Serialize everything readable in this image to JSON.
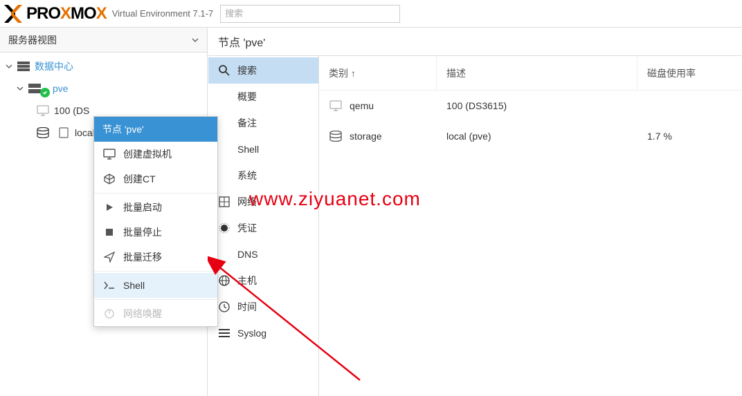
{
  "header": {
    "brand_pro": "PRO",
    "brand_x": "X",
    "brand_mo": "MO",
    "brand_x2": "X",
    "version": "Virtual Environment 7.1-7",
    "search_placeholder": "搜索"
  },
  "sidebar": {
    "view_label": "服务器视图",
    "tree": {
      "datacenter": "数据中心",
      "node": "pve",
      "vm": "100 (DS",
      "storage": "local ("
    }
  },
  "context_menu": {
    "title": "节点 'pve'",
    "items": [
      {
        "label": "创建虚拟机",
        "icon": "monitor"
      },
      {
        "label": "创建CT",
        "icon": "cube"
      },
      {
        "label": "批量启动",
        "icon": "play"
      },
      {
        "label": "批量停止",
        "icon": "stop"
      },
      {
        "label": "批量迁移",
        "icon": "send"
      },
      {
        "label": "Shell",
        "icon": "terminal",
        "hovered": true
      },
      {
        "label": "网络唤醒",
        "icon": "power",
        "disabled": true
      }
    ]
  },
  "content": {
    "title": "节点 'pve'",
    "menu": [
      {
        "label": "搜索",
        "icon": "search",
        "selected": true
      },
      {
        "label": "概要",
        "icon": ""
      },
      {
        "label": "备注",
        "icon": ""
      },
      {
        "label": "Shell",
        "icon": ""
      },
      {
        "label": "系统",
        "icon": ""
      },
      {
        "label": "网络",
        "icon": "network"
      },
      {
        "label": "凭证",
        "icon": "cert"
      },
      {
        "label": "DNS",
        "icon": ""
      },
      {
        "label": "主机",
        "icon": "globe"
      },
      {
        "label": "时间",
        "icon": "clock"
      },
      {
        "label": "Syslog",
        "icon": "list"
      }
    ],
    "columns": {
      "type": "类别 ↑",
      "desc": "描述",
      "disk": "磁盘使用率"
    },
    "rows": [
      {
        "icon": "monitor",
        "type": "qemu",
        "desc": "100 (DS3615)",
        "disk": ""
      },
      {
        "icon": "storage",
        "type": "storage",
        "desc": "local (pve)",
        "disk": "1.7 %"
      }
    ]
  },
  "watermark": "www.ziyuanet.com"
}
